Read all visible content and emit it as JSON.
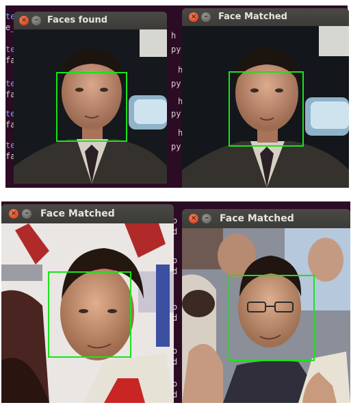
{
  "windows": [
    {
      "id": "w1",
      "title": "Faces found"
    },
    {
      "id": "w2",
      "title": "Face Matched"
    },
    {
      "id": "w3",
      "title": "Face Matched"
    },
    {
      "id": "w4",
      "title": "Face Matched"
    }
  ],
  "buttons": {
    "close_glyph": "×",
    "minimize_glyph": "–"
  },
  "terminal_fragments": {
    "top_left": [
      "te",
      "e_",
      "te",
      "fa",
      "te",
      "fa",
      "te",
      "fa",
      "te",
      "fa",
      "te",
      "fa"
    ],
    "top_mid": [
      "h",
      "py",
      "h",
      "py",
      "h",
      "py",
      "h",
      "py"
    ],
    "bottom_mid": [
      "o",
      "d",
      "o",
      "d",
      "o",
      "d",
      "o",
      "d",
      "o",
      "d",
      "o",
      "d"
    ]
  },
  "colors": {
    "face_box": "#18e418",
    "terminal_bg": "#2c0b24",
    "close_button": "#e0512a"
  },
  "icons": [
    "close-icon",
    "minimize-icon"
  ]
}
